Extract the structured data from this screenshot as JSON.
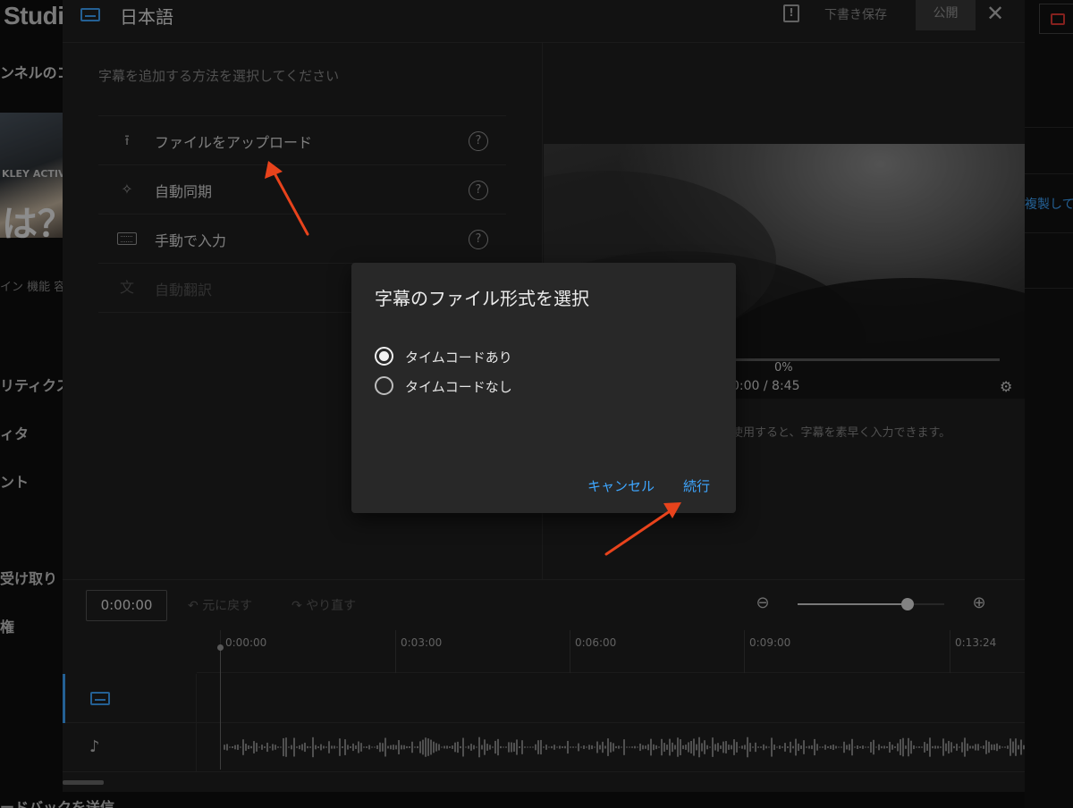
{
  "background": {
    "brand": "Studio",
    "sidebar_fragments": [
      "ンネルのコ",
      "リティクス",
      "ィタ",
      "ント",
      "受け取り",
      "権",
      "ードバックを送信"
    ],
    "thumbnail_text": [
      "KLEY ACTIVE",
      "は？"
    ],
    "thumbnail_caption": "イン 機能 容",
    "copy_link": "複製して"
  },
  "editor": {
    "language_title": "日本語",
    "draft_label": "下書き保存",
    "publish_label": "公開",
    "instruction": "字幕を追加する方法を選択してください",
    "methods": [
      {
        "label": "ファイルをアップロード",
        "icon": "upload-icon",
        "help": "?"
      },
      {
        "label": "自動同期",
        "icon": "sparkle-icon",
        "help": "?"
      },
      {
        "label": "手動で入力",
        "icon": "keyboard-icon",
        "help": "?"
      },
      {
        "label": "自動翻訳",
        "icon": "translate-icon",
        "disabled": true
      }
    ],
    "video": {
      "progress": "0%",
      "time": "0:00 / 8:45"
    },
    "hint": "使用すると、字幕を素早く入力できます。"
  },
  "timeline": {
    "timecode": "0:00:00",
    "undo_label": "元に戻す",
    "redo_label": "やり直す",
    "zoom_level": 0.75,
    "ticks": [
      "0:00:00",
      "0:03:00",
      "0:06:00",
      "0:09:00",
      "0:13:24"
    ]
  },
  "dialog": {
    "title": "字幕のファイル形式を選択",
    "options": [
      {
        "label": "タイムコードあり",
        "selected": true
      },
      {
        "label": "タイムコードなし",
        "selected": false
      }
    ],
    "cancel_label": "キャンセル",
    "continue_label": "続行"
  },
  "colors": {
    "accent": "#3ea6ff",
    "arrow": "#e8431c",
    "surface": "#1f1f1f",
    "dialog": "#282828"
  }
}
